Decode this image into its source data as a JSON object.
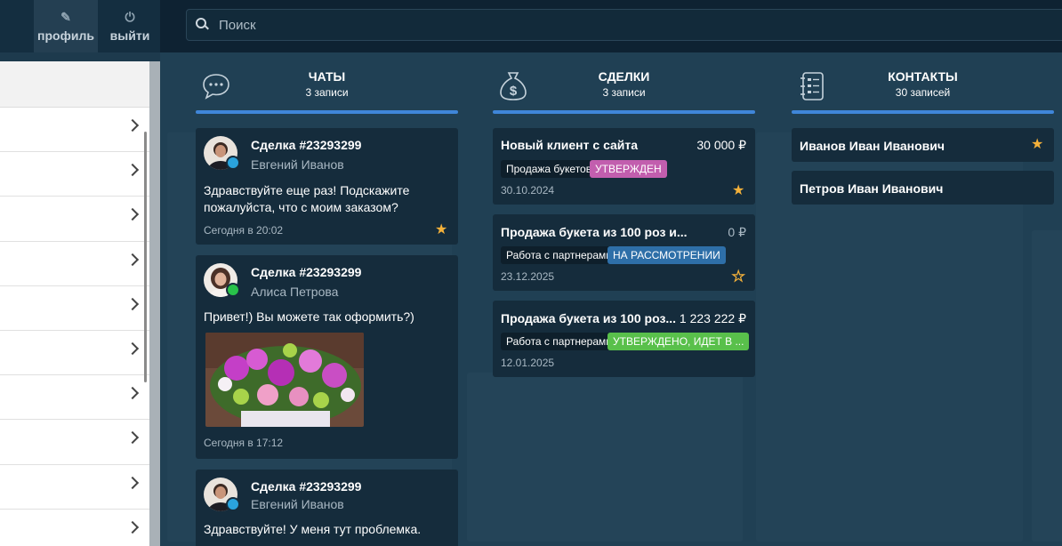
{
  "topbar": {
    "profile_label": "профиль",
    "logout_label": "выйти",
    "search_placeholder": "Поиск"
  },
  "columns": {
    "chats": {
      "title": "ЧАТЫ",
      "count": "3 записи"
    },
    "deals": {
      "title": "СДЕЛКИ",
      "count": "3 записи"
    },
    "contacts": {
      "title": "КОНТАКТЫ",
      "count": "30 записей"
    }
  },
  "chats": [
    {
      "title": "Сделка #23293299",
      "name": "Евгений Иванов",
      "message": "Здравствуйте еще раз! Подскажите пожалуйста, что с моим заказом?",
      "time": "Сегодня в 20:02",
      "channel": "telegram",
      "starred": true
    },
    {
      "title": "Сделка #23293299",
      "name": "Алиса Петрова",
      "message": "Привет!) Вы можете так оформить?)",
      "time": "Сегодня в 17:12",
      "channel": "whatsapp",
      "starred": false
    },
    {
      "title": "Сделка #23293299",
      "name": "Евгений Иванов",
      "message": "Здравствуйте! У меня тут проблемка.",
      "time": "",
      "channel": "telegram",
      "starred": false
    }
  ],
  "deals": [
    {
      "title": "Новый клиент с сайта",
      "amount": "30 000 ₽",
      "pipeline": "Продажа букетов",
      "status": "УТВЕРЖДЕН",
      "date": "30.10.2024",
      "starred": true
    },
    {
      "title": "Продажа букета из 100 роз и...",
      "amount": "0 ₽",
      "pipeline": "Работа с партнерами",
      "status": "НА РАССМОТРЕНИИ",
      "date": "23.12.2025",
      "starred": false
    },
    {
      "title": "Продажа букета из 100 роз...",
      "amount": "1 223 222 ₽",
      "pipeline": "Работа с партнерами",
      "status": "УТВЕРЖДЕНО, ИДЕТ В ...",
      "date": "12.01.2025",
      "starred": false
    }
  ],
  "contacts": [
    {
      "name": "Иванов Иван Иванович",
      "starred": true
    },
    {
      "name": "Петров Иван Иванович",
      "starred": false
    }
  ],
  "colors": {
    "accent_bar": "#3f86d9",
    "star": "#f4b13a",
    "status_approved": "#c25eae",
    "status_review": "#2e6fa8",
    "status_approved_going": "#59c04b",
    "telegram": "#2aa3dd",
    "whatsapp": "#28c24a"
  },
  "icons": {
    "profile": "pencil-icon",
    "logout": "power-icon",
    "search": "search-icon",
    "chats": "chat-bubble-icon",
    "deals": "dollar-bag-icon",
    "contacts": "contact-list-icon"
  }
}
